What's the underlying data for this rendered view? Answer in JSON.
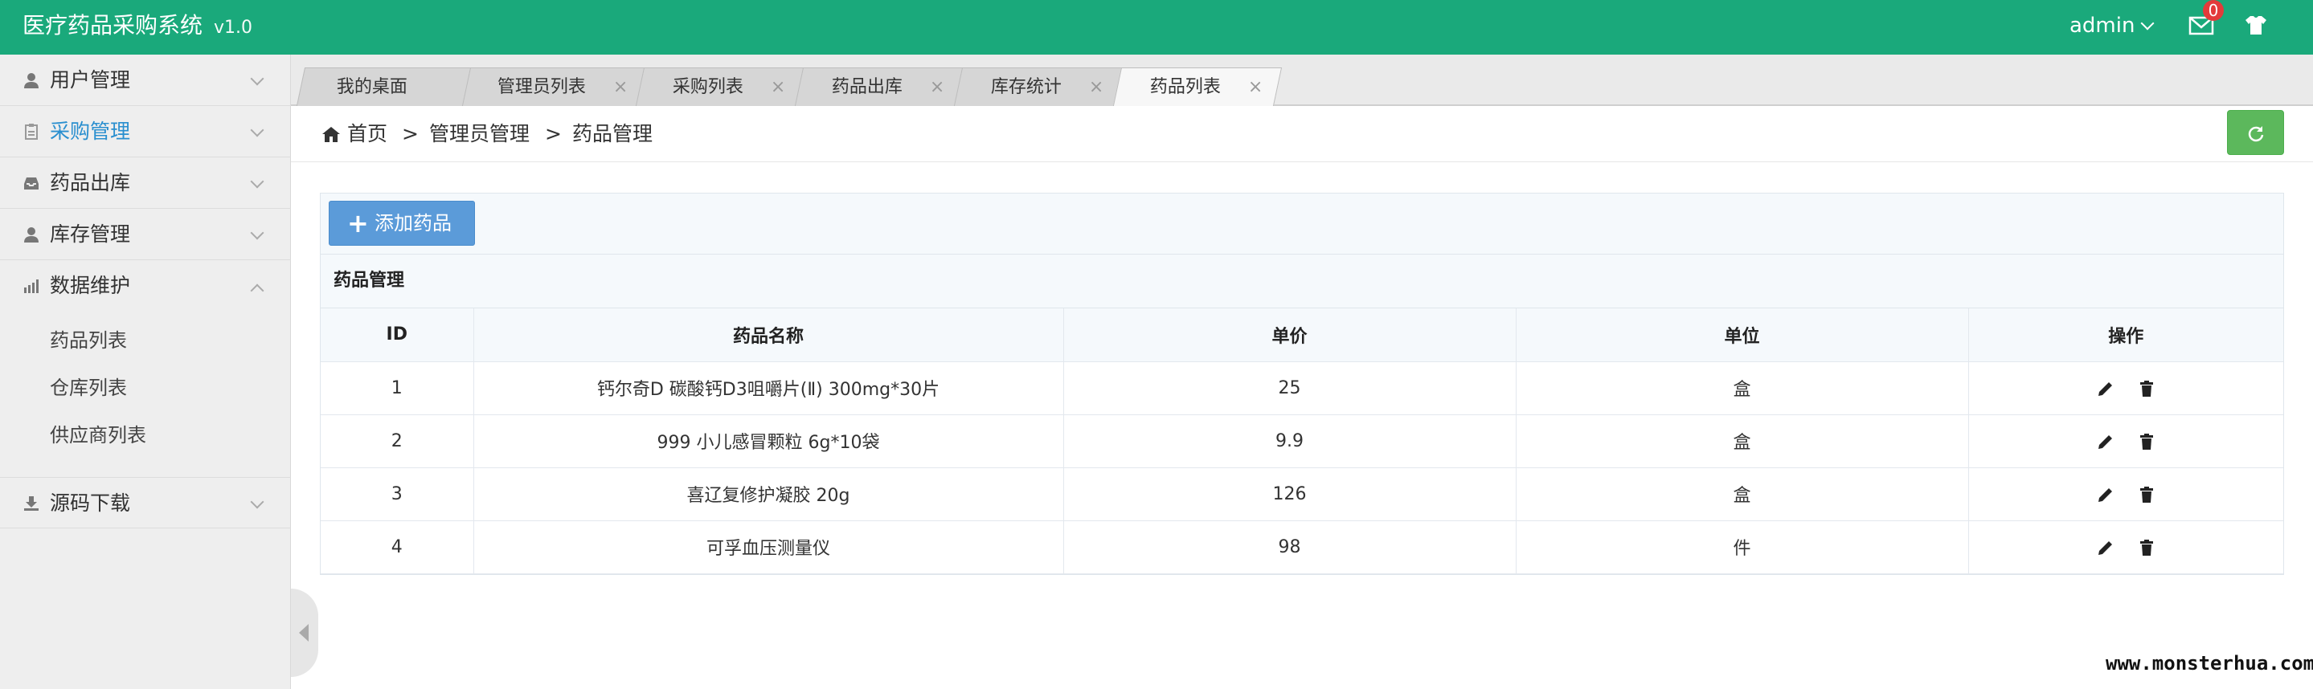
{
  "app": {
    "title": "医疗药品采购系统",
    "version": "v1.0"
  },
  "header": {
    "user": "admin",
    "mail_count": "0",
    "mail_icon": "mail-icon",
    "theme_icon": "tshirt-icon"
  },
  "sidebar": {
    "items": [
      {
        "label": "用户管理",
        "icon": "user-icon"
      },
      {
        "label": "采购管理",
        "icon": "clipboard-icon",
        "active": true
      },
      {
        "label": "药品出库",
        "icon": "inbox-icon"
      },
      {
        "label": "库存管理",
        "icon": "user-icon"
      },
      {
        "label": "数据维护",
        "icon": "bar-chart-icon",
        "expanded": true
      },
      {
        "label": "源码下载",
        "icon": "download-icon"
      }
    ],
    "submenu": [
      "药品列表",
      "仓库列表",
      "供应商列表"
    ]
  },
  "tabs": [
    {
      "label": "我的桌面"
    },
    {
      "label": "管理员列表",
      "close": "×"
    },
    {
      "label": "采购列表",
      "close": "×"
    },
    {
      "label": "药品出库",
      "close": "×"
    },
    {
      "label": "库存统计",
      "close": "×"
    },
    {
      "label": "药品列表",
      "close": "×",
      "active": true
    }
  ],
  "breadcrumb": {
    "home": "首页",
    "sep": ">",
    "level1": "管理员管理",
    "level2": "药品管理"
  },
  "toolbar": {
    "add_label": "添加药品",
    "add_icon": "+"
  },
  "panel": {
    "title": "药品管理"
  },
  "table": {
    "columns": [
      "ID",
      "药品名称",
      "单价",
      "单位",
      "操作"
    ],
    "rows": [
      {
        "id": "1",
        "name": "钙尔奇D 碳酸钙D3咀嚼片(Ⅱ) 300mg*30片",
        "price": "25",
        "unit": "盒"
      },
      {
        "id": "2",
        "name": "999 小儿感冒颗粒 6g*10袋",
        "price": "9.9",
        "unit": "盒"
      },
      {
        "id": "3",
        "name": "喜辽复修护凝胶 20g",
        "price": "126",
        "unit": "盒"
      },
      {
        "id": "4",
        "name": "可孚血压测量仪",
        "price": "98",
        "unit": "件"
      }
    ]
  },
  "watermark": "www.monsterhua.com",
  "colors": {
    "header": "#1aa97b",
    "active_menu": "#2a8fcf",
    "add_button": "#5b9bd9",
    "refresh_button": "#5cb85c"
  }
}
